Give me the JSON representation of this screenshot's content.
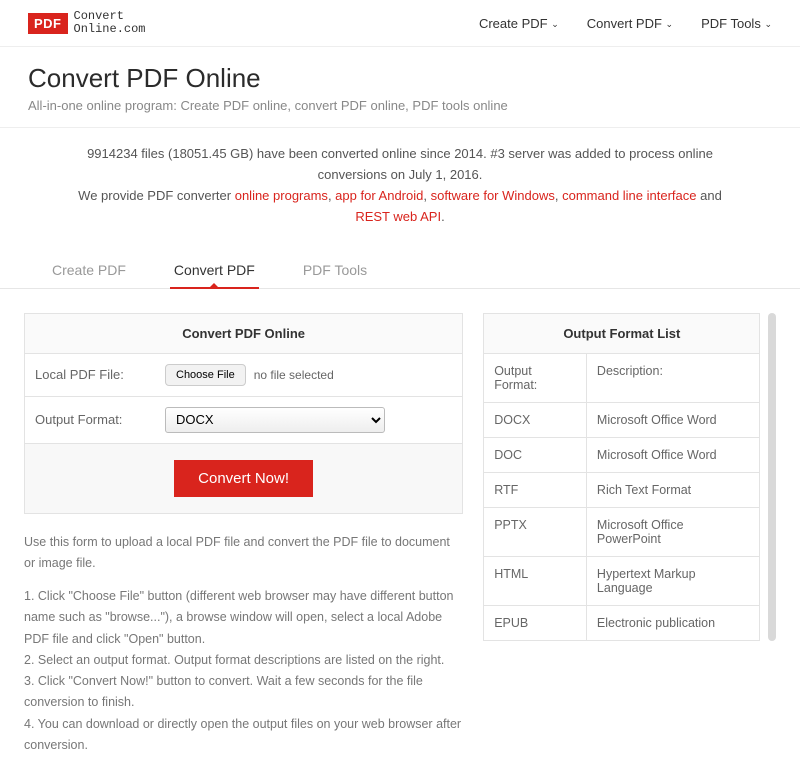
{
  "logo": {
    "badge": "PDF",
    "line1": "Convert",
    "line2": "Online.com"
  },
  "topnav": {
    "create": "Create PDF",
    "convert": "Convert PDF",
    "tools": "PDF Tools"
  },
  "title": {
    "heading": "Convert PDF Online",
    "sub": "All-in-one online program: Create PDF online, convert PDF online, PDF tools online"
  },
  "stats": {
    "line1": "9914234 files (18051.45 GB) have been converted online since 2014. #3 server was added to process online conversions on July 1, 2016.",
    "prefix": "We provide PDF converter ",
    "links": {
      "a": "online programs",
      "b": "app for Android",
      "c": "software for Windows",
      "d": "command line interface",
      "e": "REST web API"
    },
    "sep": ", ",
    "and": " and ",
    "period": "."
  },
  "tabs": {
    "create": "Create PDF",
    "convert": "Convert PDF",
    "tools": "PDF Tools"
  },
  "form": {
    "panel_title": "Convert PDF Online",
    "file_label": "Local PDF File:",
    "choose_label": "Choose File",
    "nofile": "no file selected",
    "format_label": "Output Format:",
    "selected_format": "DOCX",
    "convert_btn": "Convert Now!"
  },
  "instructions": {
    "intro": "Use this form to upload a local PDF file and convert the PDF file to document or image file.",
    "s1": "1. Click \"Choose File\" button (different web browser may have different button name such as \"browse...\"), a browse window will open, select a local Adobe PDF file and click \"Open\" button.",
    "s2": "2. Select an output format. Output format descriptions are listed on the right.",
    "s3": "3. Click \"Convert Now!\" button to convert. Wait a few seconds for the file conversion to finish.",
    "s4": "4. You can download or directly open the output files on your web browser after conversion."
  },
  "outlist": {
    "title": "Output Format List",
    "col1": "Output Format:",
    "col2": "Description:",
    "rows": [
      {
        "fmt": "DOCX",
        "desc": "Microsoft Office Word"
      },
      {
        "fmt": "DOC",
        "desc": "Microsoft Office Word"
      },
      {
        "fmt": "RTF",
        "desc": "Rich Text Format"
      },
      {
        "fmt": "PPTX",
        "desc": "Microsoft Office PowerPoint"
      },
      {
        "fmt": "HTML",
        "desc": "Hypertext Markup Language"
      },
      {
        "fmt": "EPUB",
        "desc": "Electronic publication"
      }
    ]
  }
}
